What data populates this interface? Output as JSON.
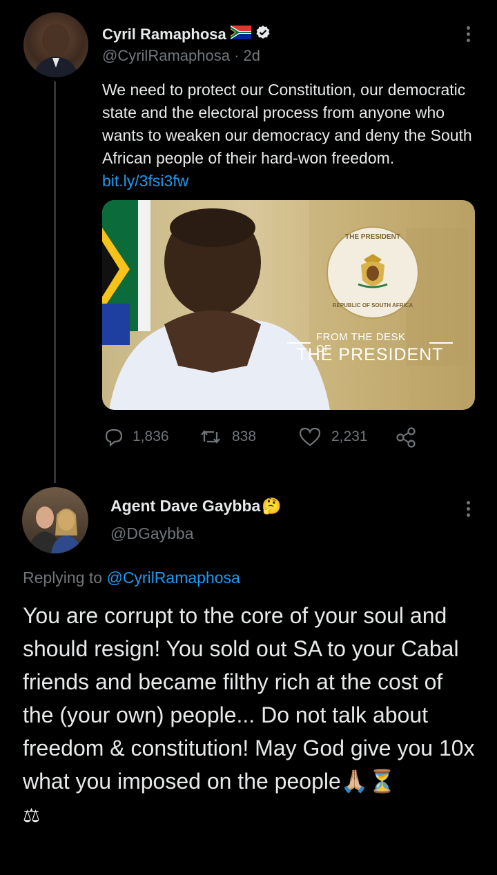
{
  "original_tweet": {
    "author_name": "Cyril Ramaphosa",
    "flag_emoji": "🇿🇦",
    "handle": "@CyrilRamaphosa",
    "separator": "·",
    "time": "2d",
    "body_text": "We need to protect our Constitution, our democratic state and the electoral process from anyone who wants to weaken our democracy and deny the South African people of their hard-won freedom.",
    "link_text": "bit.ly/3fsi3fw",
    "card": {
      "seal_top_text": "THE PRESIDENT",
      "seal_bottom_text": "REPUBLIC OF SOUTH AFRICA",
      "kicker": "FROM THE DESK OF",
      "headline": "THE PRESIDENT"
    },
    "stats": {
      "replies": "1,836",
      "retweets": "838",
      "likes": "2,231"
    }
  },
  "reply_tweet": {
    "author_name": "Agent Dave Gaybba",
    "name_emoji": "🤔",
    "handle": "@DGaybba",
    "replying_prefix": "Replying to",
    "replying_to": "@CyrilRamaphosa",
    "body_text": "You are corrupt to the core of your soul and should resign! You sold out SA to your Cabal friends and became filthy rich at the cost of the (your own) people... Do not talk about freedom & constitution! May God give you 10x what you imposed on the people",
    "trailing_emojis": "🙏🏼⏳",
    "last_line_emoji": "⚖"
  },
  "colors": {
    "background": "#000000",
    "text": "#e7e9ea",
    "muted": "#71767b",
    "link": "#1d9bf0",
    "thread_line": "#333639"
  }
}
